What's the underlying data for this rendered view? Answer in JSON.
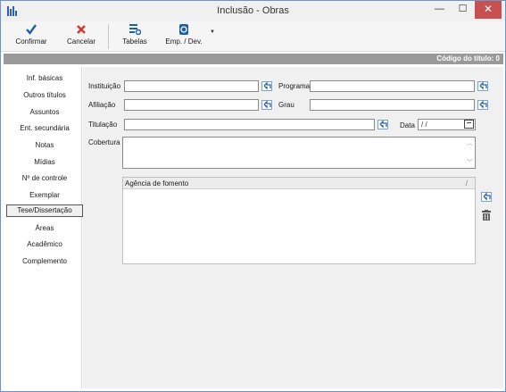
{
  "window": {
    "title": "Inclusão - Obras",
    "minimize": "—",
    "maximize": "☐",
    "close": "✕"
  },
  "toolbar": {
    "confirm_label": "Confirmar",
    "cancel_label": "Cancelar",
    "tables_label": "Tabelas",
    "loan_label": "Emp. / Dev.",
    "dropdown_arrow": "▼"
  },
  "header": {
    "code_label": "Código do título: 0"
  },
  "sidebar": {
    "items": [
      {
        "label": "Inf. básicas"
      },
      {
        "label": "Outros títulos"
      },
      {
        "label": "Assuntos"
      },
      {
        "label": "Ent. secundária"
      },
      {
        "label": "Notas"
      },
      {
        "label": "Mídias"
      },
      {
        "label": "Nº de controle"
      },
      {
        "label": "Exemplar"
      },
      {
        "label": "Tese/Dissertação",
        "active": true
      },
      {
        "label": "Áreas"
      },
      {
        "label": "Acadêmico"
      },
      {
        "label": "Complemento"
      }
    ]
  },
  "form": {
    "instituicao_label": "Instituição",
    "programa_label": "Programa",
    "afiliacao_label": "Afiliação",
    "grau_label": "Grau",
    "titulacao_label": "Titulação",
    "data_label": "Data",
    "data_value": " /  /",
    "cobertura_label": "Cobertura"
  },
  "grid": {
    "column": "Agência de fomento",
    "sort_marker": "/"
  },
  "icons": {
    "lookup": "lookup-arrow-icon",
    "calendar": "calendar-icon",
    "trash": "trash-icon",
    "accent": "#2a63b5",
    "cancel_red": "#d03a2f",
    "check_blue": "#1f5fa8"
  }
}
